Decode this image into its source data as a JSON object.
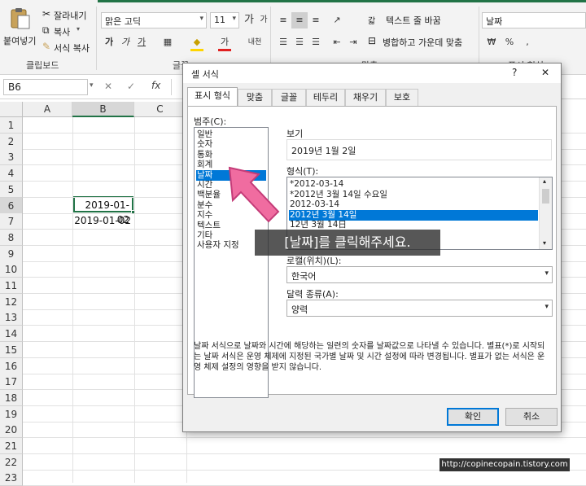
{
  "ribbon": {
    "cut": "잘라내기",
    "copy": "복사",
    "format_painter": "서식 복사",
    "paste": "붙여넣기",
    "clipboard_label": "클립보드",
    "font_name": "맑은 고딕",
    "font_size": "11",
    "font_group_label": "글꼴",
    "wrap_text": "텍스트 줄 바꿈",
    "merge_center": "병합하고 가운데 맞춤",
    "align_group_label": "맞춤",
    "number_format": "날짜",
    "number_group_label": "표시 형식",
    "bold": "가",
    "italic": "가",
    "underline": "가",
    "grow_font": "가",
    "shrink_font": "가",
    "font_color": "가",
    "phonetic": "내천",
    "wrap_prefix": "갋"
  },
  "formula_bar": {
    "name_box": "B6",
    "cancel": "✕",
    "enter": "✓",
    "fx": "fx"
  },
  "grid": {
    "columns": [
      "A",
      "B",
      "C"
    ],
    "rows": [
      "1",
      "2",
      "3",
      "4",
      "5",
      "6",
      "7",
      "8",
      "9",
      "10",
      "11",
      "12",
      "13",
      "14",
      "15",
      "16",
      "17",
      "18",
      "19",
      "20",
      "21",
      "22",
      "23"
    ],
    "b6": "2019-01-02",
    "b7": "2019-01-02"
  },
  "dialog": {
    "title": "셀 서식",
    "help": "?",
    "close": "✕",
    "tabs": [
      "표시 형식",
      "맞춤",
      "글꼴",
      "테두리",
      "채우기",
      "보호"
    ],
    "category_label": "범주(C):",
    "categories": [
      "일반",
      "숫자",
      "통화",
      "회계",
      "날짜",
      "시간",
      "백분율",
      "분수",
      "지수",
      "텍스트",
      "기타",
      "사용자 지정"
    ],
    "selected_category": "날짜",
    "sample_label": "보기",
    "sample_value": "2019년 1월 2일",
    "type_label": "형식(T):",
    "types": [
      "*2012-03-14",
      "*2012년 3월 14일 수요일",
      "2012-03-14",
      "2012년 3월 14일",
      "12년 3월 14日",
      "",
      ""
    ],
    "selected_type": "2012년 3월 14일",
    "locale_label": "로캘(위치)(L):",
    "locale_value": "한국어",
    "calendar_label": "달력 종류(A):",
    "calendar_value": "양력",
    "description": "날짜 서식으로 날짜와 시간에 해당하는 일련의 숫자를 날짜값으로 나타낼 수 있습니다. 별표(*)로 시작되는 날짜 서식은 운영 체제에 지정된 국가별 날짜 및 시간 설정에 따라 변경됩니다. 별표가 없는 서식은 운영 체제 설정의 영향을 받지 않습니다.",
    "ok": "확인",
    "cancel": "취소"
  },
  "overlay": {
    "callout": "[날짜]를 클릭해주세요.",
    "credit": "http://copinecopain.tistory.com"
  },
  "colors": {
    "accent": "#0078d7",
    "arrow": "#f06ca0"
  }
}
